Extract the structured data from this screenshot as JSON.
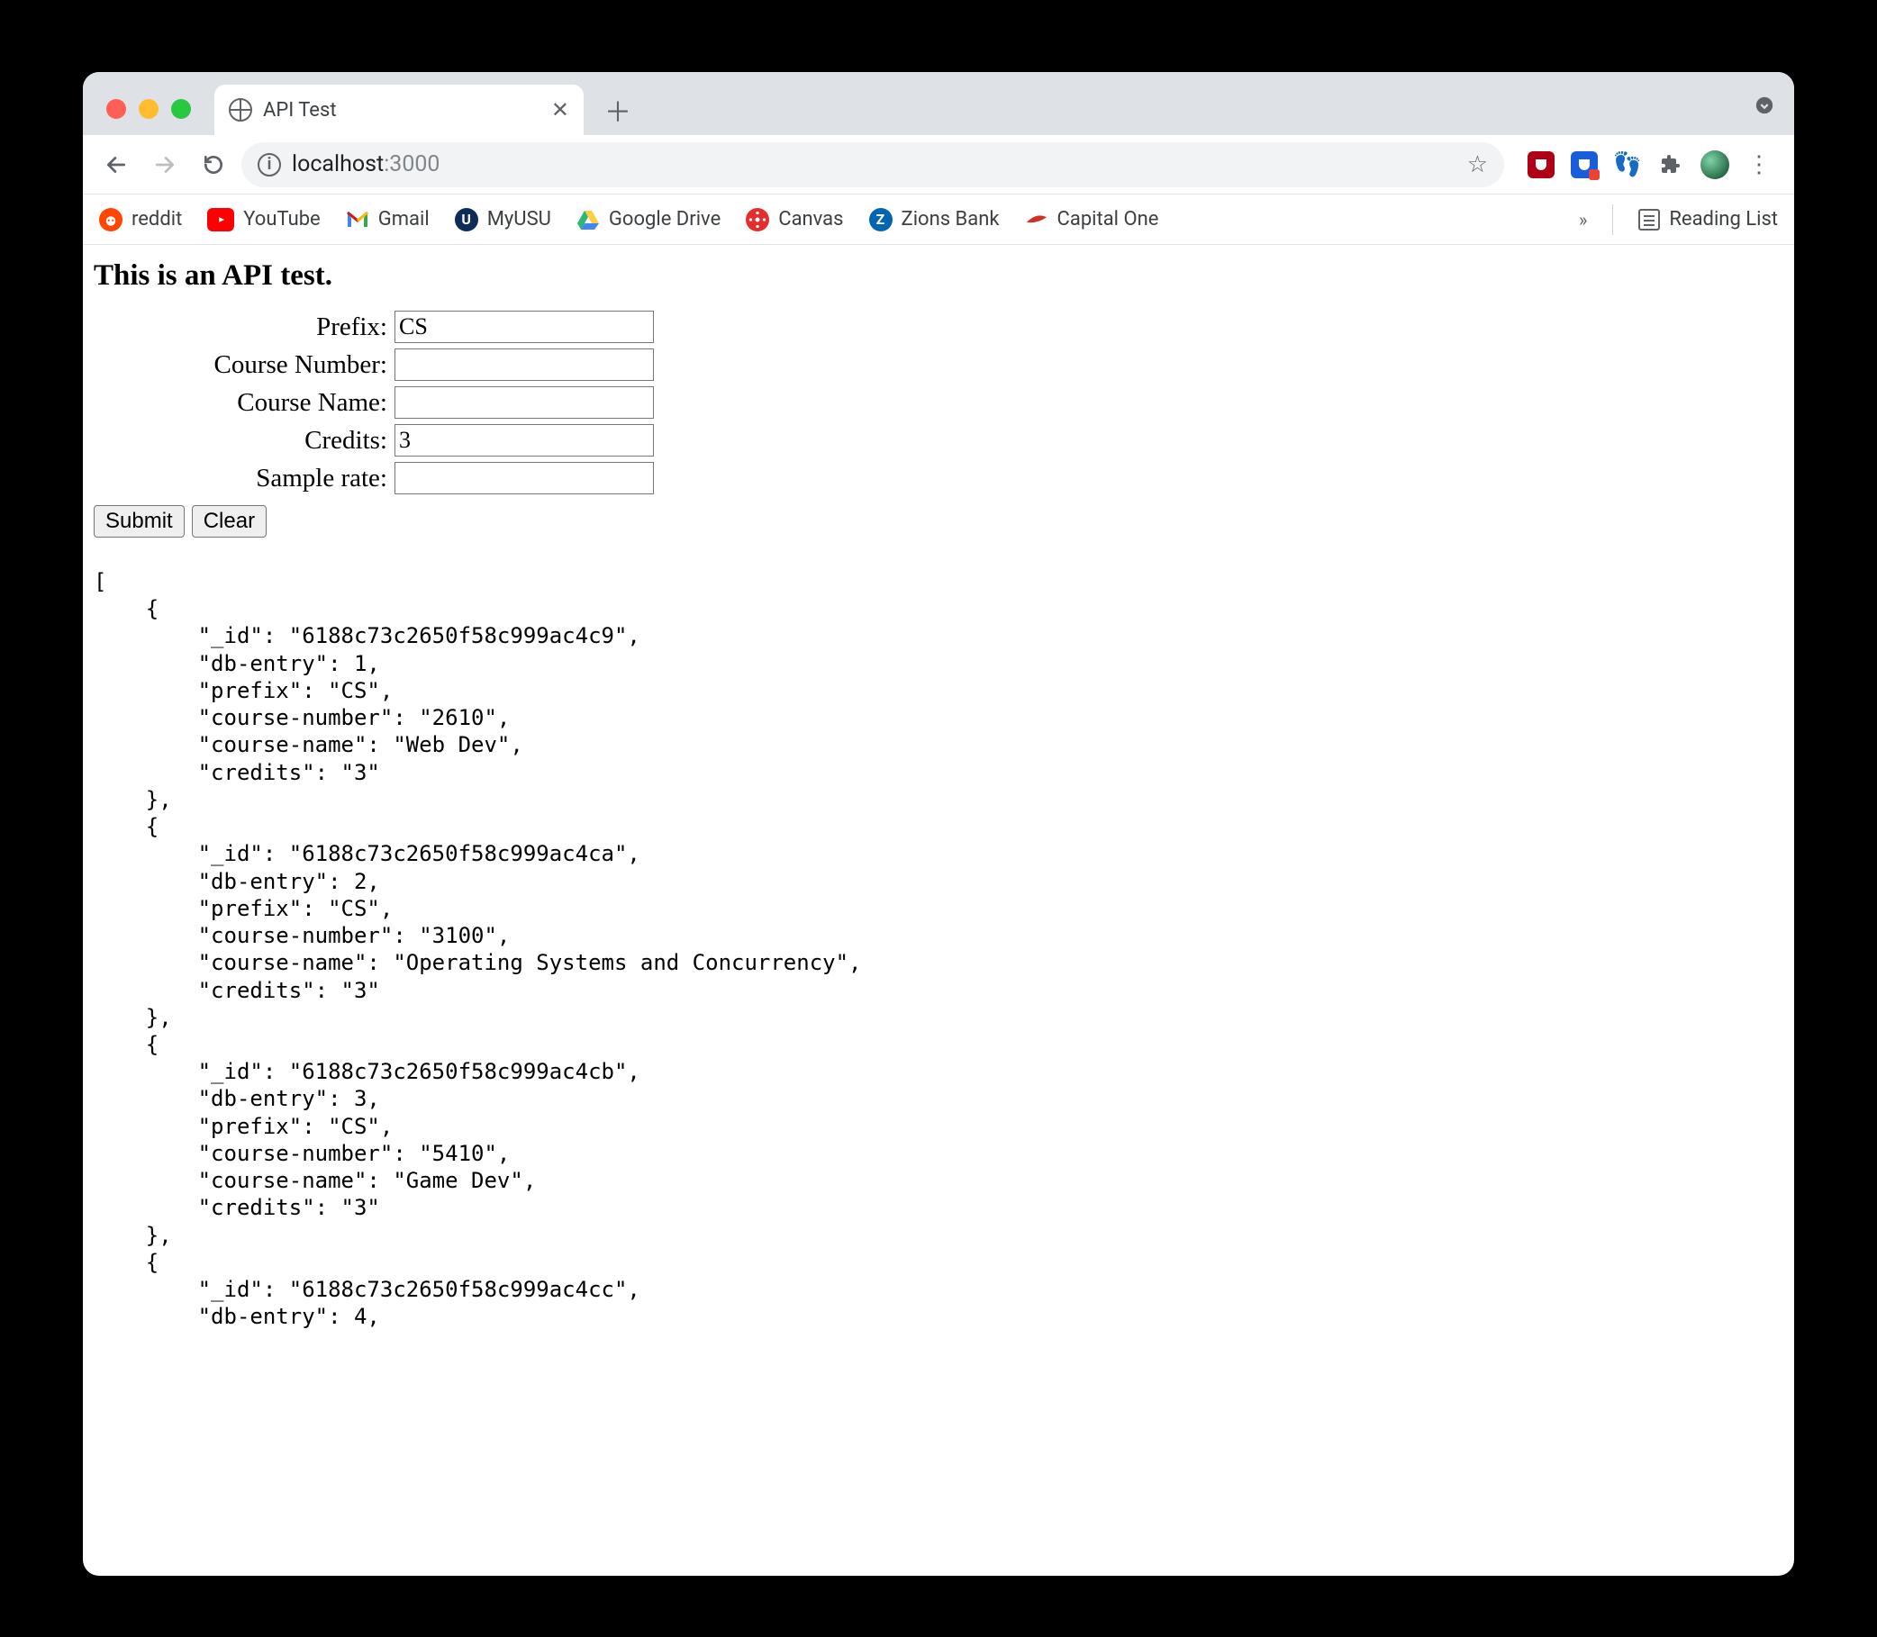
{
  "browser": {
    "tab_title": "API Test",
    "url_host": "localhost",
    "url_port": ":3000",
    "bookmarks": [
      {
        "label": "reddit"
      },
      {
        "label": "YouTube"
      },
      {
        "label": "Gmail"
      },
      {
        "label": "MyUSU"
      },
      {
        "label": "Google Drive"
      },
      {
        "label": "Canvas"
      },
      {
        "label": "Zions Bank"
      },
      {
        "label": "Capital One"
      }
    ],
    "reading_list_label": "Reading List",
    "overflow_symbol": "»"
  },
  "page": {
    "heading": "This is an API test.",
    "form": {
      "prefix_label": "Prefix:",
      "prefix_value": "CS",
      "course_number_label": "Course Number:",
      "course_number_value": "",
      "course_name_label": "Course Name:",
      "course_name_value": "",
      "credits_label": "Credits:",
      "credits_value": "3",
      "sample_rate_label": "Sample rate:",
      "sample_rate_value": "",
      "submit_label": "Submit",
      "clear_label": "Clear"
    },
    "output_text": "[\n    {\n        \"_id\": \"6188c73c2650f58c999ac4c9\",\n        \"db-entry\": 1,\n        \"prefix\": \"CS\",\n        \"course-number\": \"2610\",\n        \"course-name\": \"Web Dev\",\n        \"credits\": \"3\"\n    },\n    {\n        \"_id\": \"6188c73c2650f58c999ac4ca\",\n        \"db-entry\": 2,\n        \"prefix\": \"CS\",\n        \"course-number\": \"3100\",\n        \"course-name\": \"Operating Systems and Concurrency\",\n        \"credits\": \"3\"\n    },\n    {\n        \"_id\": \"6188c73c2650f58c999ac4cb\",\n        \"db-entry\": 3,\n        \"prefix\": \"CS\",\n        \"course-number\": \"5410\",\n        \"course-name\": \"Game Dev\",\n        \"credits\": \"3\"\n    },\n    {\n        \"_id\": \"6188c73c2650f58c999ac4cc\",\n        \"db-entry\": 4,"
  }
}
